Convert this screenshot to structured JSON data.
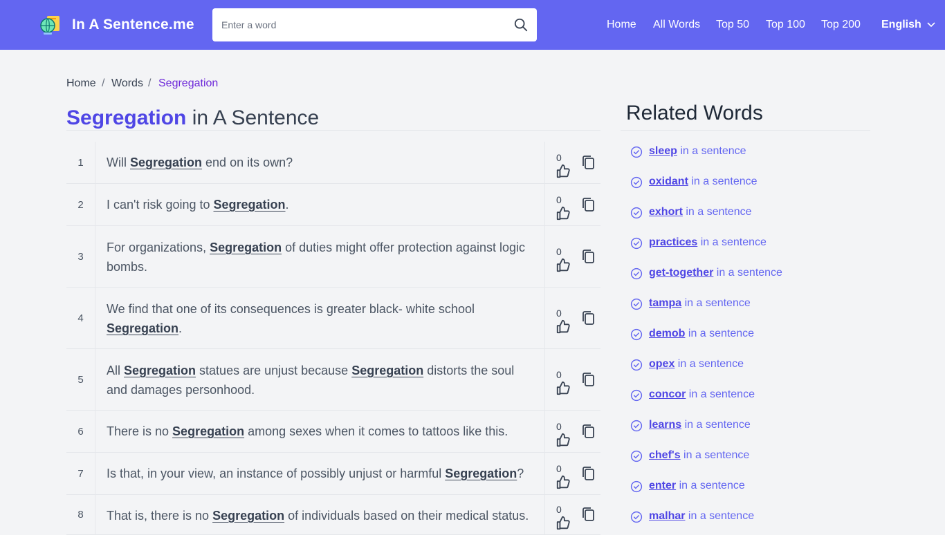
{
  "header": {
    "brand": "In A Sentence.me",
    "search_placeholder": "Enter a word",
    "nav": [
      "Home",
      "All Words",
      "Top 50",
      "Top 100",
      "Top 200"
    ],
    "language": "English"
  },
  "breadcrumb": [
    "Home",
    "Words",
    "Segregation"
  ],
  "page": {
    "word": "Segregation",
    "title_suffix": "in A Sentence"
  },
  "sentences": [
    {
      "num": "1",
      "votes": "0",
      "parts": [
        "Will ",
        "Segregation",
        " end on its own?"
      ]
    },
    {
      "num": "2",
      "votes": "0",
      "parts": [
        "I can't risk going to ",
        "Segregation",
        "."
      ]
    },
    {
      "num": "3",
      "votes": "0",
      "parts": [
        "For organizations, ",
        "Segregation",
        " of duties might offer protection against logic bombs."
      ]
    },
    {
      "num": "4",
      "votes": "0",
      "parts": [
        "We find that one of its consequences is greater black- white school ",
        "Segregation",
        "."
      ]
    },
    {
      "num": "5",
      "votes": "0",
      "parts": [
        "All ",
        "Segregation",
        " statues are unjust because ",
        "Segregation",
        " distorts the soul and damages personhood."
      ]
    },
    {
      "num": "6",
      "votes": "0",
      "parts": [
        "There is no ",
        "Segregation",
        " among sexes when it comes to tattoos like this."
      ]
    },
    {
      "num": "7",
      "votes": "0",
      "parts": [
        "Is that, in your view, an instance of possibly unjust or harmful ",
        "Segregation",
        "?"
      ]
    },
    {
      "num": "8",
      "votes": "0",
      "parts": [
        "That is, there is no ",
        "Segregation",
        " of individuals based on their medical status."
      ]
    }
  ],
  "related": {
    "title": "Related Words",
    "suffix": "in a sentence",
    "words": [
      "sleep",
      "oxidant",
      "exhort",
      "practices",
      "get-together",
      "tampa",
      "demob",
      "opex",
      "concor",
      "learns",
      "chef's",
      "enter",
      "malhar"
    ]
  },
  "colors": {
    "header": "#6366f1",
    "accent": "#4f46e5",
    "background": "#f3f4f6"
  },
  "icons": {
    "logo": "globe-book-icon",
    "search": "search-icon",
    "chevron": "chevron-down-icon",
    "vote": "thumbs-up-icon",
    "copy": "copy-icon",
    "related": "check-circle-icon"
  }
}
